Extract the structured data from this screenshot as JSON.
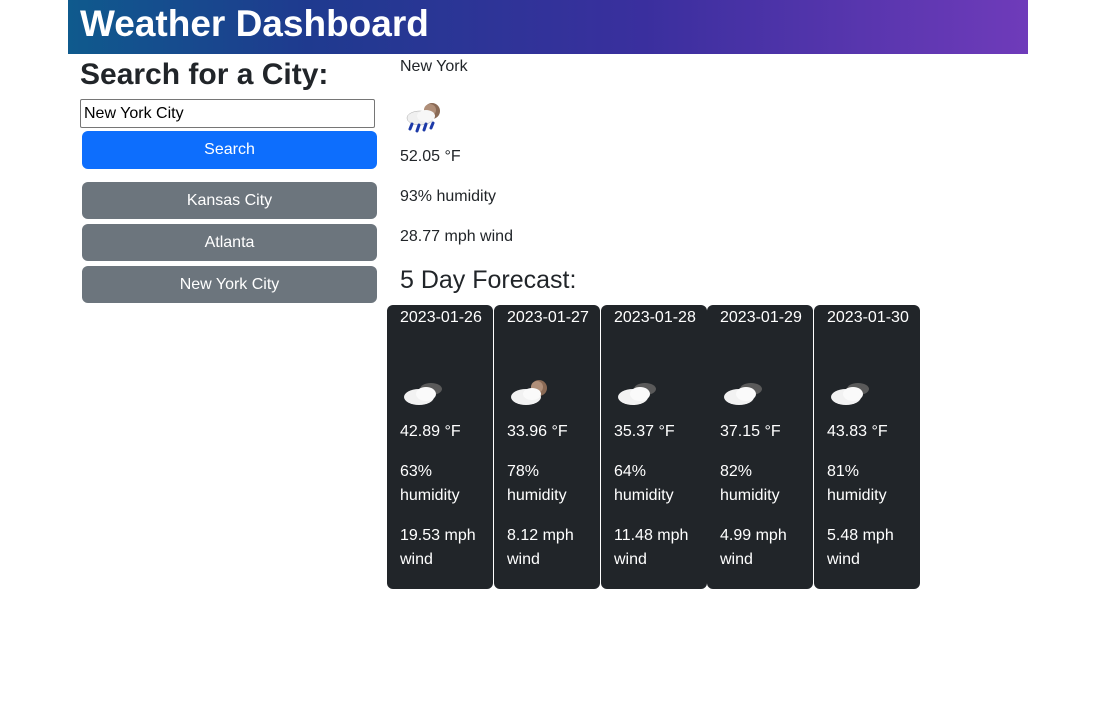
{
  "header": {
    "title": "Weather Dashboard"
  },
  "search": {
    "heading": "Search for a City:",
    "input_value": "New York City",
    "button_label": "Search"
  },
  "history": [
    {
      "label": "Kansas City"
    },
    {
      "label": "Atlanta"
    },
    {
      "label": "New York City"
    }
  ],
  "current": {
    "city": "New York",
    "icon": "rain-cloud-icon",
    "temp": "52.05 °F",
    "humidity": "93% humidity",
    "wind": "28.77 mph wind"
  },
  "forecast": {
    "title": "5 Day Forecast:",
    "days": [
      {
        "date": "2023-01-26",
        "icon": "cloud-night-icon",
        "temp": "42.89 °F",
        "humidity": "63% humidity",
        "wind": "19.53 mph wind"
      },
      {
        "date": "2023-01-27",
        "icon": "cloud-moon-icon",
        "temp": "33.96 °F",
        "humidity": "78% humidity",
        "wind": "8.12 mph wind"
      },
      {
        "date": "2023-01-28",
        "icon": "cloud-night-icon",
        "temp": "35.37 °F",
        "humidity": "64% humidity",
        "wind": "11.48 mph wind"
      },
      {
        "date": "2023-01-29",
        "icon": "cloud-night-icon",
        "temp": "37.15 °F",
        "humidity": "82% humidity",
        "wind": "4.99 mph wind"
      },
      {
        "date": "2023-01-30",
        "icon": "cloud-night-icon",
        "temp": "43.83 °F",
        "humidity": "81% humidity",
        "wind": "5.48 mph wind"
      }
    ]
  },
  "colors": {
    "primary_button": "#0d6efd",
    "history_button": "#6c757d",
    "card_bg": "#212529"
  }
}
